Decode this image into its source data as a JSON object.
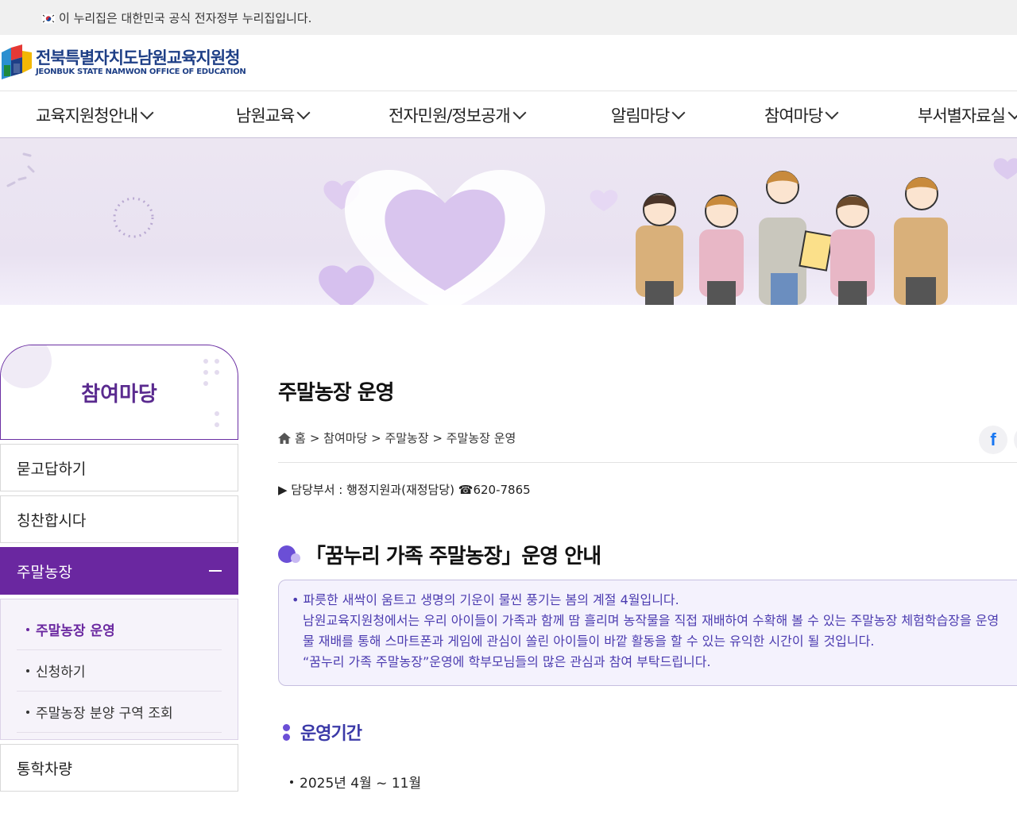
{
  "gov_banner": {
    "text": "이 누리집은 대한민국 공식 전자정부 누리집입니다."
  },
  "logo": {
    "name_ko": "전북특별자치도남원교육지원청",
    "name_en": "JEONBUK STATE NAMWON OFFICE OF EDUCATION"
  },
  "gnb": {
    "items": [
      {
        "label": "교육지원청안내"
      },
      {
        "label": "남원교육"
      },
      {
        "label": "전자민원/정보공개"
      },
      {
        "label": "알림마당"
      },
      {
        "label": "참여마당"
      },
      {
        "label": "부서별자료실"
      }
    ]
  },
  "lnb": {
    "title": "참여마당",
    "items": [
      {
        "label": "묻고답하기"
      },
      {
        "label": "칭찬합시다"
      },
      {
        "label": "주말농장"
      },
      {
        "label": "통학차량"
      }
    ],
    "sub_items": [
      {
        "label": "주말농장 운영"
      },
      {
        "label": "신청하기"
      },
      {
        "label": "주말농장 분양 구역 조회"
      }
    ]
  },
  "main": {
    "page_title": "주말농장 운영",
    "breadcrumb": {
      "home": "홈",
      "path": "> 참여마당 > 주말농장 > 주말농장 운영"
    },
    "dept": "▶ 담당부서 : 행정지원과(재정담당) ☎620-7865",
    "section_title": "「꿈누리 가족 주말농장」운영 안내",
    "intro": {
      "lines": [
        "파릇한 새싹이 움트고 생명의 기운이 물씬 풍기는 봄의 계절 4월입니다.",
        "남원교육지원청에서는 우리 아이들이 가족과 함께 땀 흘리며 농작물을 직접 재배하여 수확해 볼 수 있는 주말농장 체험학습장을 운영",
        "물 재배를 통해 스마트폰과 게임에 관심이 쏠린 아이들이 바깥 활동을 할 수 있는 유익한 시간이 될 것입니다.",
        "“꿈누리 가족 주말농장”운영에 학부모님들의 많은 관심과 참여 부탁드립니다."
      ]
    },
    "period_title": "운영기간",
    "period_value": "2025년 4월 ~ 11월"
  },
  "colors": {
    "brand": "#6a27a0",
    "logo": "#1e3f86",
    "info_text": "#4b3bb0",
    "info_bg": "#f4f2fd"
  }
}
